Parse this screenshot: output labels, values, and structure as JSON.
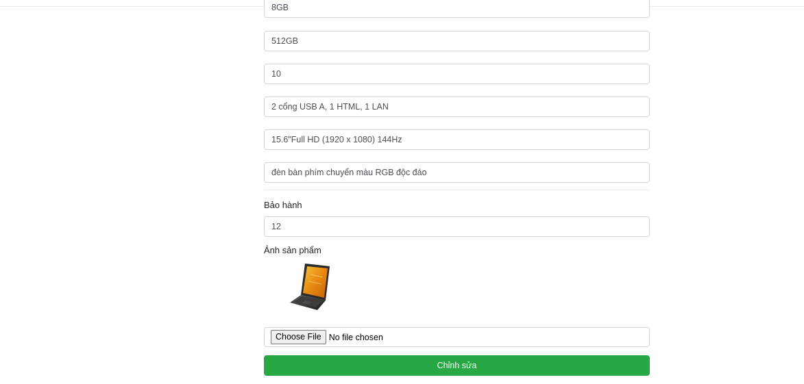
{
  "form": {
    "fields": [
      {
        "value": "8GB"
      },
      {
        "value": "512GB"
      },
      {
        "value": "10"
      },
      {
        "value": "2 cổng USB A, 1 HTML, 1 LAN"
      },
      {
        "value": "15.6\"Full HD (1920 x 1080) 144Hz"
      },
      {
        "value": "đèn bàn phím chuyển màu RGB độc đáo"
      }
    ],
    "warranty": {
      "label": "Bảo hành",
      "value": "12"
    },
    "image": {
      "label": "Ảnh sản phẩm",
      "icon": "laptop-image"
    },
    "file_input": {
      "button_label": "Choose File",
      "status": "No file chosen"
    },
    "submit_label": "Chỉnh sửa"
  },
  "colors": {
    "submit": "#28a745",
    "border": "#ced4da"
  }
}
